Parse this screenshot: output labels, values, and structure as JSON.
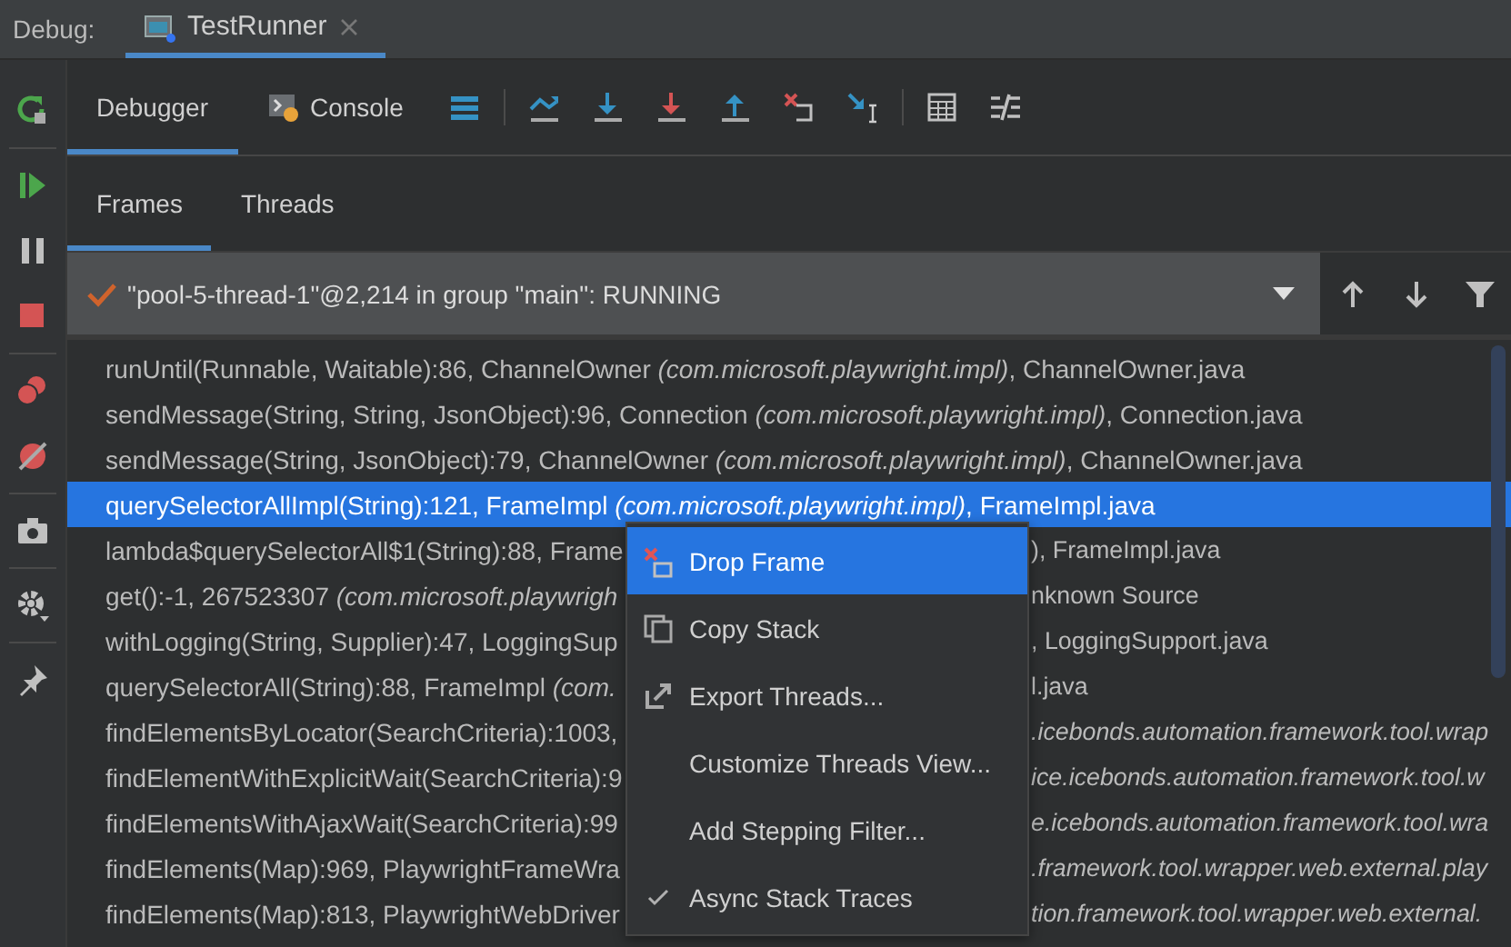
{
  "tool_window": {
    "label": "Debug:",
    "tabs": [
      {
        "label": "TestRunner",
        "selected": true
      }
    ]
  },
  "toolbar_tabs": [
    {
      "label": "Debugger",
      "selected": true
    },
    {
      "label": "Console",
      "selected": false
    }
  ],
  "subtabs": [
    {
      "label": "Frames",
      "selected": true
    },
    {
      "label": "Threads",
      "selected": false
    }
  ],
  "thread": {
    "label": "\"pool-5-thread-1\"@2,214 in group \"main\": RUNNING"
  },
  "frames": [
    {
      "left": "runUntil(Runnable, Waitable):86, ChannelOwner *(com.microsoft.playwright.impl)*, ChannelOwner.java",
      "selected": false
    },
    {
      "left": "sendMessage(String, String, JsonObject):96, Connection *(com.microsoft.playwright.impl)*, Connection.java",
      "selected": false
    },
    {
      "left": "sendMessage(String, JsonObject):79, ChannelOwner *(com.microsoft.playwright.impl)*, ChannelOwner.java",
      "selected": false
    },
    {
      "left": "querySelectorAllImpl(String):121, FrameImpl *(com.microsoft.playwright.impl)*, FrameImpl.java",
      "selected": true
    },
    {
      "left": "lambda$querySelectorAll$1(String):88, Frame",
      "right": "), FrameImpl.java",
      "selected": false
    },
    {
      "left": "get():-1, 267523307 *(com.microsoft.playwrigh*",
      "right": "nknown Source",
      "selected": false
    },
    {
      "left": "withLogging(String, Supplier):47, LoggingSup",
      "right": ", LoggingSupport.java",
      "selected": false
    },
    {
      "left": "querySelectorAll(String):88, FrameImpl *(com.*",
      "right": "l.java",
      "selected": false
    },
    {
      "left": "findElementsByLocator(SearchCriteria):1003,",
      "right": "*.icebonds.automation.framework.tool.wrap*",
      "selected": false
    },
    {
      "left": "findElementWithExplicitWait(SearchCriteria):9",
      "right": "*ice.icebonds.automation.framework.tool.w*",
      "selected": false
    },
    {
      "left": "findElementsWithAjaxWait(SearchCriteria):99",
      "right": "*e.icebonds.automation.framework.tool.wra*",
      "selected": false
    },
    {
      "left": "findElements(Map):969, PlaywrightFrameWra",
      "right": "*.framework.tool.wrapper.web.external.play*",
      "selected": false
    },
    {
      "left": "findElements(Map):813, PlaywrightWebDriver",
      "right": "*tion.framework.tool.wrapper.web.external.*",
      "selected": false
    }
  ],
  "context_menu": [
    {
      "label": "Drop Frame",
      "kind": "drop",
      "selected": true,
      "checked": false
    },
    {
      "label": "Copy Stack",
      "kind": "copy",
      "selected": false,
      "checked": false
    },
    {
      "label": "Export Threads...",
      "kind": "export",
      "selected": false,
      "checked": false
    },
    {
      "label": "Customize Threads View...",
      "kind": "plain",
      "selected": false,
      "checked": false
    },
    {
      "label": "Add Stepping Filter...",
      "kind": "plain",
      "selected": false,
      "checked": false
    },
    {
      "label": "Async Stack Traces",
      "kind": "plain",
      "selected": false,
      "checked": true
    }
  ]
}
